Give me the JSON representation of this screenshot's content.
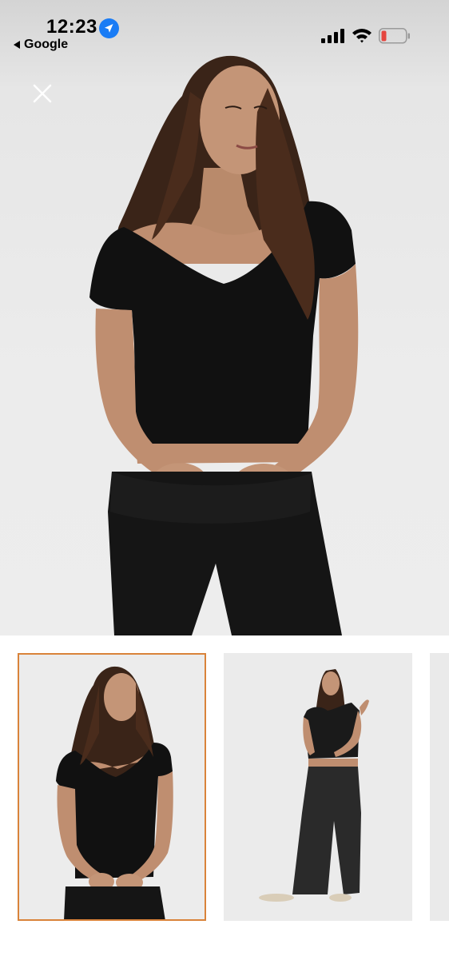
{
  "status_bar": {
    "time": "12:23",
    "back_app": "Google",
    "battery_color": "#e5463f"
  },
  "gallery": {
    "selected_thumbnail_index": 0,
    "selected_border_color": "#d9833a",
    "thumbnails": [
      {
        "name": "product-photo-front-closeup"
      },
      {
        "name": "product-photo-full-length"
      },
      {
        "name": "product-photo-partial"
      }
    ]
  }
}
